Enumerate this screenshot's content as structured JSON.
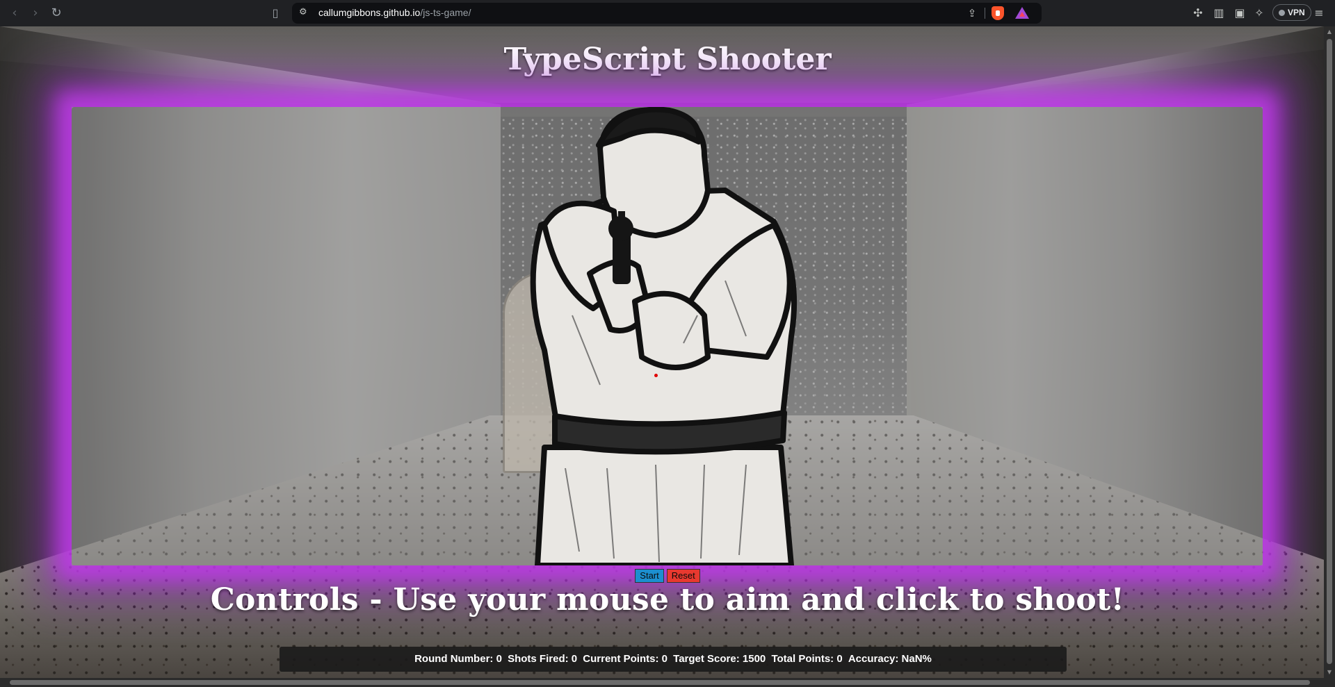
{
  "browser": {
    "url_host": "callumgibbons.github.io",
    "url_path": "/js-ts-game/",
    "vpn_label": "VPN",
    "icons": {
      "back": "back-arrow-icon",
      "forward": "forward-arrow-icon",
      "reload": "reload-icon",
      "bookmark": "bookmark-icon",
      "site_info": "site-settings-icon",
      "share": "share-icon",
      "brave": "brave-shields-icon",
      "rewards": "brave-rewards-icon",
      "extensions": "extensions-icon",
      "sidebar": "sidebar-icon",
      "wallet": "wallet-icon",
      "leo": "leo-ai-icon",
      "menu": "menu-icon"
    }
  },
  "game": {
    "title": "TypeScript Shooter",
    "start_label": "Start",
    "reset_label": "Reset",
    "controls_text": "Controls - Use your mouse to aim and click to shoot!",
    "stats": {
      "round": "Round Number: 0",
      "shots": "Shots Fired: 0",
      "current": "Current Points: 0",
      "target": "Target Score: 1500",
      "total": "Total Points: 0",
      "accuracy": "Accuracy: NaN%"
    },
    "colors": {
      "glow": "#be3ce6",
      "start_button": "#1c8fcf",
      "reset_button": "#e8392f"
    }
  }
}
